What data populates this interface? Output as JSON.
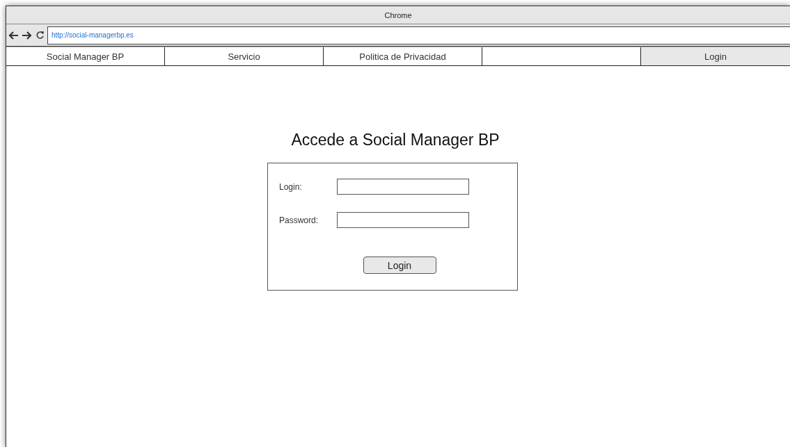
{
  "window": {
    "title": "Chrome"
  },
  "address_bar": {
    "url": "http://social-managerbp.es"
  },
  "nav": [
    {
      "label": "Social Manager BP",
      "selected": false
    },
    {
      "label": "Servicio",
      "selected": false
    },
    {
      "label": "Politica de Privacidad",
      "selected": false
    },
    {
      "selected": false
    },
    {
      "label": "Login",
      "selected": true
    }
  ],
  "heading": "Accede a Social Manager BP",
  "form": {
    "fields": [
      {
        "label": "Login:"
      },
      {
        "label": "Password:"
      }
    ],
    "button": "Login"
  }
}
